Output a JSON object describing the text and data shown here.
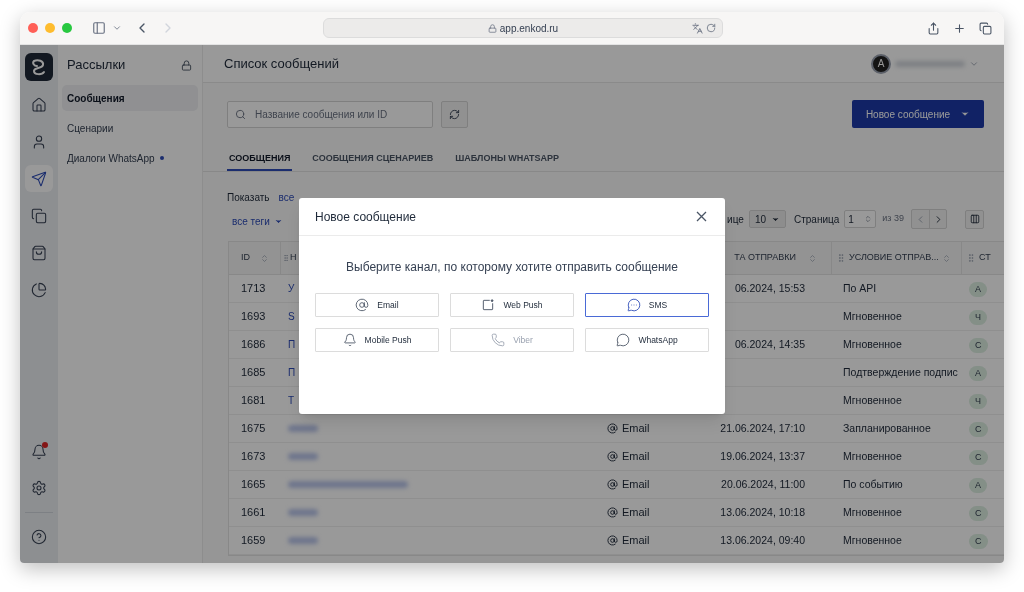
{
  "browser": {
    "url": "app.enkod.ru"
  },
  "rail": {
    "top": [
      {
        "kind": "home",
        "selected": false
      },
      {
        "kind": "user",
        "selected": false
      },
      {
        "kind": "send",
        "selected": true
      },
      {
        "kind": "copy",
        "selected": false
      },
      {
        "kind": "bag",
        "selected": false
      },
      {
        "kind": "pie",
        "selected": false
      }
    ],
    "bottom": [
      {
        "kind": "bell",
        "badge": true
      },
      {
        "kind": "gear",
        "badge": false
      },
      {
        "kind": "help",
        "badge": false
      }
    ]
  },
  "sidebar": {
    "title": "Рассылки",
    "items": [
      {
        "label": "Сообщения",
        "selected": true,
        "dot": false
      },
      {
        "label": "Сценарии",
        "selected": false,
        "dot": false
      },
      {
        "label": "Диалоги WhatsApp",
        "selected": false,
        "dot": true
      }
    ]
  },
  "header": {
    "title": "Список сообщений",
    "avatar": "A"
  },
  "search": {
    "placeholder": "Название сообщения или ID"
  },
  "new_button": "Новое сообщение",
  "tabs": [
    {
      "label": "СООБЩЕНИЯ",
      "selected": true
    },
    {
      "label": "СООБЩЕНИЯ СЦЕНАРИЕВ",
      "selected": false
    },
    {
      "label": "ШАБЛОНЫ WHATSAPP",
      "selected": false
    }
  ],
  "filters": {
    "show_label": "Показать",
    "show_value": "все",
    "tags": "все теги"
  },
  "pagination": {
    "per_page_label": "ице",
    "per_page": "10",
    "page_label": "Страница",
    "page": "1",
    "total": "из 39"
  },
  "table": {
    "id_header": "ID",
    "name_header": "Н",
    "date_header": "ТА ОТПРАВКИ",
    "condition_header": "УСЛОВИЕ ОТПРАВ...",
    "status_header": "СТ",
    "rows": [
      {
        "id": "1713",
        "name": "У",
        "date": "06.2024, 15:53",
        "condition": "По API",
        "status": "А"
      },
      {
        "id": "1693",
        "name": "S",
        "condition": "Мгновенное",
        "status": "Ч"
      },
      {
        "id": "1686",
        "name": "П",
        "date": "06.2024, 14:35",
        "condition": "Мгновенное",
        "status": "С"
      },
      {
        "id": "1685",
        "name": "П",
        "condition": "Подтверждение подпис",
        "status": "А"
      },
      {
        "id": "1681",
        "name": "Т",
        "condition": "Мгновенное",
        "status": "Ч"
      },
      {
        "id": "1675",
        "channel": "Email",
        "date": "21.06.2024, 17:10",
        "condition": "Запланированное",
        "status": "С"
      },
      {
        "id": "1673",
        "channel": "Email",
        "date": "19.06.2024, 13:37",
        "condition": "Мгновенное",
        "status": "С"
      },
      {
        "id": "1665",
        "channel": "Email",
        "date": "20.06.2024, 11:00",
        "condition": "По событию",
        "status": "А"
      },
      {
        "id": "1661",
        "channel": "Email",
        "date": "13.06.2024, 10:18",
        "condition": "Мгновенное",
        "status": "С"
      },
      {
        "id": "1659",
        "channel": "Email",
        "date": "13.06.2024, 09:40",
        "condition": "Мгновенное",
        "status": "С"
      }
    ]
  },
  "modal": {
    "title": "Новое сообщение",
    "prompt": "Выберите канал, по которому хотите отправить сообщение",
    "channels": [
      {
        "label": "Email",
        "kind": "email",
        "selected": false,
        "disabled": false
      },
      {
        "label": "Web Push",
        "kind": "webpush",
        "selected": false,
        "disabled": false
      },
      {
        "label": "SMS",
        "kind": "sms",
        "selected": true,
        "disabled": false
      },
      {
        "label": "Mobile Push",
        "kind": "mobile",
        "selected": false,
        "disabled": false
      },
      {
        "label": "Viber",
        "kind": "viber",
        "selected": false,
        "disabled": true
      },
      {
        "label": "WhatsApp",
        "kind": "whatsapp",
        "selected": false,
        "disabled": false
      }
    ]
  }
}
